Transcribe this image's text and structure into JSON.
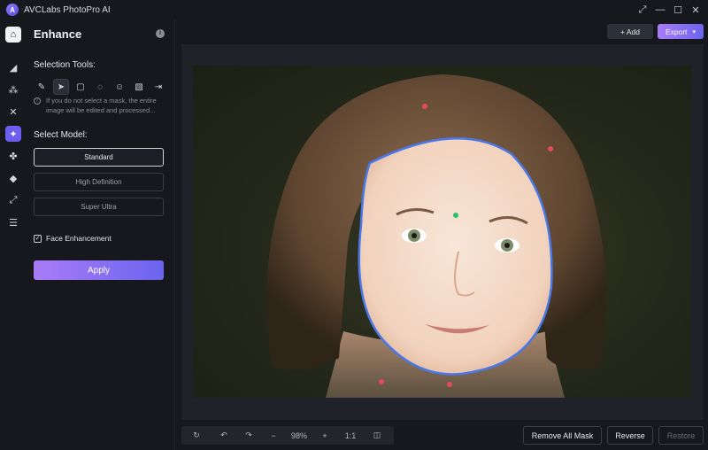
{
  "app": {
    "title": "AVCLabs PhotoPro AI",
    "logo_text": "A"
  },
  "window_controls": [
    "⤢",
    "—",
    "☐",
    "✕"
  ],
  "panel": {
    "title": "Enhance",
    "selection_tools_label": "Selection Tools:",
    "hint": "If you do not select a mask, the entire image will be edited and processed...",
    "select_model_label": "Select Model:",
    "models": [
      "Standard",
      "High Definition",
      "Super Ultra"
    ],
    "selected_model": "Standard",
    "face_enhancement_label": "Face Enhancement",
    "face_enhancement_checked": true,
    "apply_label": "Apply"
  },
  "topbar": {
    "add_label": "+ Add",
    "export_label": "Export"
  },
  "zoom": {
    "level": "98%",
    "ratio": "1:1"
  },
  "actions": {
    "remove_all_mask": "Remove All Mask",
    "reverse": "Reverse",
    "restore": "Restore"
  },
  "colors": {
    "accent": "#6d5ef0",
    "mask_outline": "#4a78e8"
  }
}
